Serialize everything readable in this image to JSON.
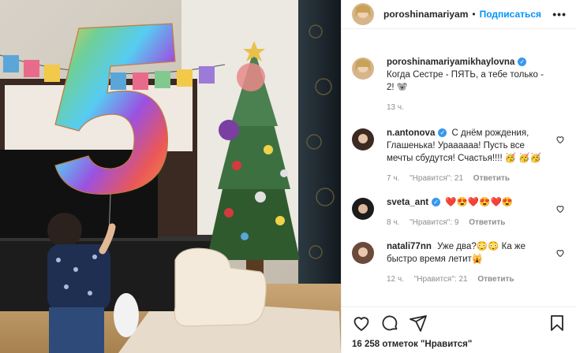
{
  "post": {
    "author": "poroshinamariyam",
    "follow_label": "Подписаться",
    "separator": "•",
    "more_label": "•••",
    "likes_text": "16 258 отметок \"Нравится\""
  },
  "caption": {
    "username": "poroshinamariyamikhaylovna",
    "text": "Когда Сестре - ПЯТЬ, а тебе только - 2! 🐨",
    "time": "13 ч."
  },
  "comments": [
    {
      "username": "n.antonova",
      "verified": true,
      "text": "С днём рождения, Глашенька! Ураааааа! Пусть все мечты сбудутся! Счастья!!!! 🥳 🥳🥳",
      "time": "7 ч.",
      "likes": "\"Нравится\": 21",
      "reply": "Ответить"
    },
    {
      "username": "sveta_ant",
      "verified": true,
      "text": "❤️😍❤️😍❤️😍",
      "time": "8 ч.",
      "likes": "\"Нравится\": 9",
      "reply": "Ответить"
    },
    {
      "username": "natali77nn",
      "verified": false,
      "text": "Уже два?😳😳 Ка же быстро время летит🙀",
      "time": "12 ч.",
      "likes": "\"Нравится\": 21",
      "reply": "Ответить"
    }
  ],
  "icons": [
    "heart-icon",
    "comment-icon",
    "share-icon",
    "bookmark-icon"
  ],
  "colors": {
    "accent": "#0095f6",
    "verified": "#3897f0",
    "muted": "#8e8e8e"
  }
}
